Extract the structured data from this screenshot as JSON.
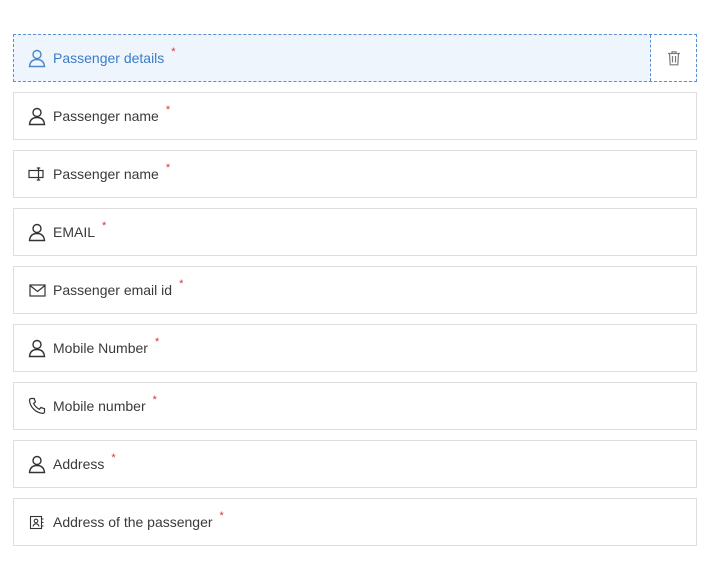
{
  "accent": "#3d7cc6",
  "required_color": "#e0303a",
  "fields": [
    {
      "label": "Passenger details",
      "required_mark": "*",
      "icon": "person-icon",
      "selected": true
    },
    {
      "label": "Passenger name",
      "required_mark": "*",
      "icon": "person-icon"
    },
    {
      "label": "Passenger name",
      "required_mark": "*",
      "icon": "text-field-icon"
    },
    {
      "label": "EMAIL",
      "required_mark": "*",
      "icon": "person-icon"
    },
    {
      "label": "Passenger email id",
      "required_mark": "*",
      "icon": "envelope-icon"
    },
    {
      "label": "Mobile Number",
      "required_mark": "*",
      "icon": "person-icon"
    },
    {
      "label": "Mobile number",
      "required_mark": "*",
      "icon": "phone-icon"
    },
    {
      "label": "Address",
      "required_mark": "*",
      "icon": "person-icon"
    },
    {
      "label": "Address of the passenger",
      "required_mark": "*",
      "icon": "address-card-icon"
    }
  ],
  "selected_actions": {
    "delete_icon": "trash-icon"
  }
}
